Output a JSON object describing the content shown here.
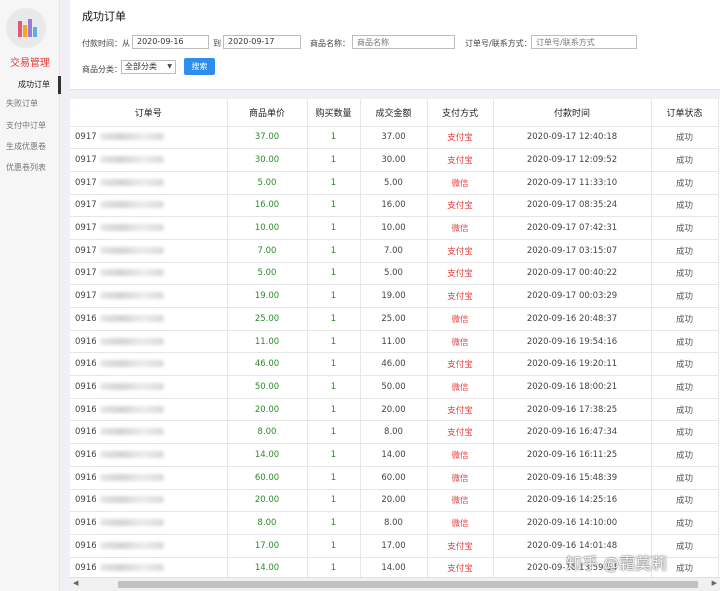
{
  "sidebar": {
    "title": "交易管理",
    "items": [
      {
        "label": "成功订单",
        "active": true
      },
      {
        "label": "失败订单",
        "active": false
      },
      {
        "label": "支付中订单",
        "active": false
      },
      {
        "label": "生成优惠卷",
        "active": false
      },
      {
        "label": "优惠卷列表",
        "active": false
      }
    ]
  },
  "filter": {
    "title": "成功订单",
    "date_from_label": "付款时间：从",
    "date_from": "2020-09-16",
    "date_to_label": "到",
    "date_to": "2020-09-17",
    "product_label": "商品名称：",
    "product_placeholder": "商品名称",
    "order_label": "订单号/联系方式：",
    "order_placeholder": "订单号/联系方式",
    "category_label": "商品分类：",
    "category_value": "全部分类",
    "search_button": "搜索"
  },
  "table": {
    "headers": [
      "订单号",
      "商品单价",
      "购买数量",
      "成交金额",
      "支付方式",
      "付款时间",
      "订单状态"
    ],
    "rows": [
      {
        "order_no": "0917",
        "price": "37.00",
        "qty": "1",
        "amount": "37.00",
        "pay": "支付宝",
        "time": "2020-09-17 12:40:18",
        "status": "成功"
      },
      {
        "order_no": "0917",
        "price": "30.00",
        "qty": "1",
        "amount": "30.00",
        "pay": "支付宝",
        "time": "2020-09-17 12:09:52",
        "status": "成功"
      },
      {
        "order_no": "0917",
        "price": "5.00",
        "qty": "1",
        "amount": "5.00",
        "pay": "微信",
        "time": "2020-09-17 11:33:10",
        "status": "成功"
      },
      {
        "order_no": "0917",
        "price": "16.00",
        "qty": "1",
        "amount": "16.00",
        "pay": "支付宝",
        "time": "2020-09-17 08:35:24",
        "status": "成功"
      },
      {
        "order_no": "0917",
        "price": "10.00",
        "qty": "1",
        "amount": "10.00",
        "pay": "微信",
        "time": "2020-09-17 07:42:31",
        "status": "成功"
      },
      {
        "order_no": "0917",
        "price": "7.00",
        "qty": "1",
        "amount": "7.00",
        "pay": "支付宝",
        "time": "2020-09-17 03:15:07",
        "status": "成功"
      },
      {
        "order_no": "0917",
        "price": "5.00",
        "qty": "1",
        "amount": "5.00",
        "pay": "支付宝",
        "time": "2020-09-17 00:40:22",
        "status": "成功"
      },
      {
        "order_no": "0917",
        "price": "19.00",
        "qty": "1",
        "amount": "19.00",
        "pay": "支付宝",
        "time": "2020-09-17 00:03:29",
        "status": "成功"
      },
      {
        "order_no": "0916",
        "price": "25.00",
        "qty": "1",
        "amount": "25.00",
        "pay": "微信",
        "time": "2020-09-16 20:48:37",
        "status": "成功"
      },
      {
        "order_no": "0916",
        "price": "11.00",
        "qty": "1",
        "amount": "11.00",
        "pay": "微信",
        "time": "2020-09-16 19:54:16",
        "status": "成功"
      },
      {
        "order_no": "0916",
        "price": "46.00",
        "qty": "1",
        "amount": "46.00",
        "pay": "支付宝",
        "time": "2020-09-16 19:20:11",
        "status": "成功"
      },
      {
        "order_no": "0916",
        "price": "50.00",
        "qty": "1",
        "amount": "50.00",
        "pay": "微信",
        "time": "2020-09-16 18:00:21",
        "status": "成功"
      },
      {
        "order_no": "0916",
        "price": "20.00",
        "qty": "1",
        "amount": "20.00",
        "pay": "支付宝",
        "time": "2020-09-16 17:38:25",
        "status": "成功"
      },
      {
        "order_no": "0916",
        "price": "8.00",
        "qty": "1",
        "amount": "8.00",
        "pay": "支付宝",
        "time": "2020-09-16 16:47:34",
        "status": "成功"
      },
      {
        "order_no": "0916",
        "price": "14.00",
        "qty": "1",
        "amount": "14.00",
        "pay": "微信",
        "time": "2020-09-16 16:11:25",
        "status": "成功"
      },
      {
        "order_no": "0916",
        "price": "60.00",
        "qty": "1",
        "amount": "60.00",
        "pay": "微信",
        "time": "2020-09-16 15:48:39",
        "status": "成功"
      },
      {
        "order_no": "0916",
        "price": "20.00",
        "qty": "1",
        "amount": "20.00",
        "pay": "微信",
        "time": "2020-09-16 14:25:16",
        "status": "成功"
      },
      {
        "order_no": "0916",
        "price": "8.00",
        "qty": "1",
        "amount": "8.00",
        "pay": "微信",
        "time": "2020-09-16 14:10:00",
        "status": "成功"
      },
      {
        "order_no": "0916",
        "price": "17.00",
        "qty": "1",
        "amount": "17.00",
        "pay": "支付宝",
        "time": "2020-09-16 14:01:48",
        "status": "成功"
      },
      {
        "order_no": "0916",
        "price": "14.00",
        "qty": "1",
        "amount": "14.00",
        "pay": "支付宝",
        "time": "2020-09-16 13:59:54",
        "status": "成功"
      }
    ]
  },
  "watermark": "知乎 @霜莫莉",
  "colors": {
    "accent": "#2e8ded",
    "alipay": "#e33c3c",
    "price": "#2a8b2a",
    "sidebar_title": "#e23b3b"
  }
}
